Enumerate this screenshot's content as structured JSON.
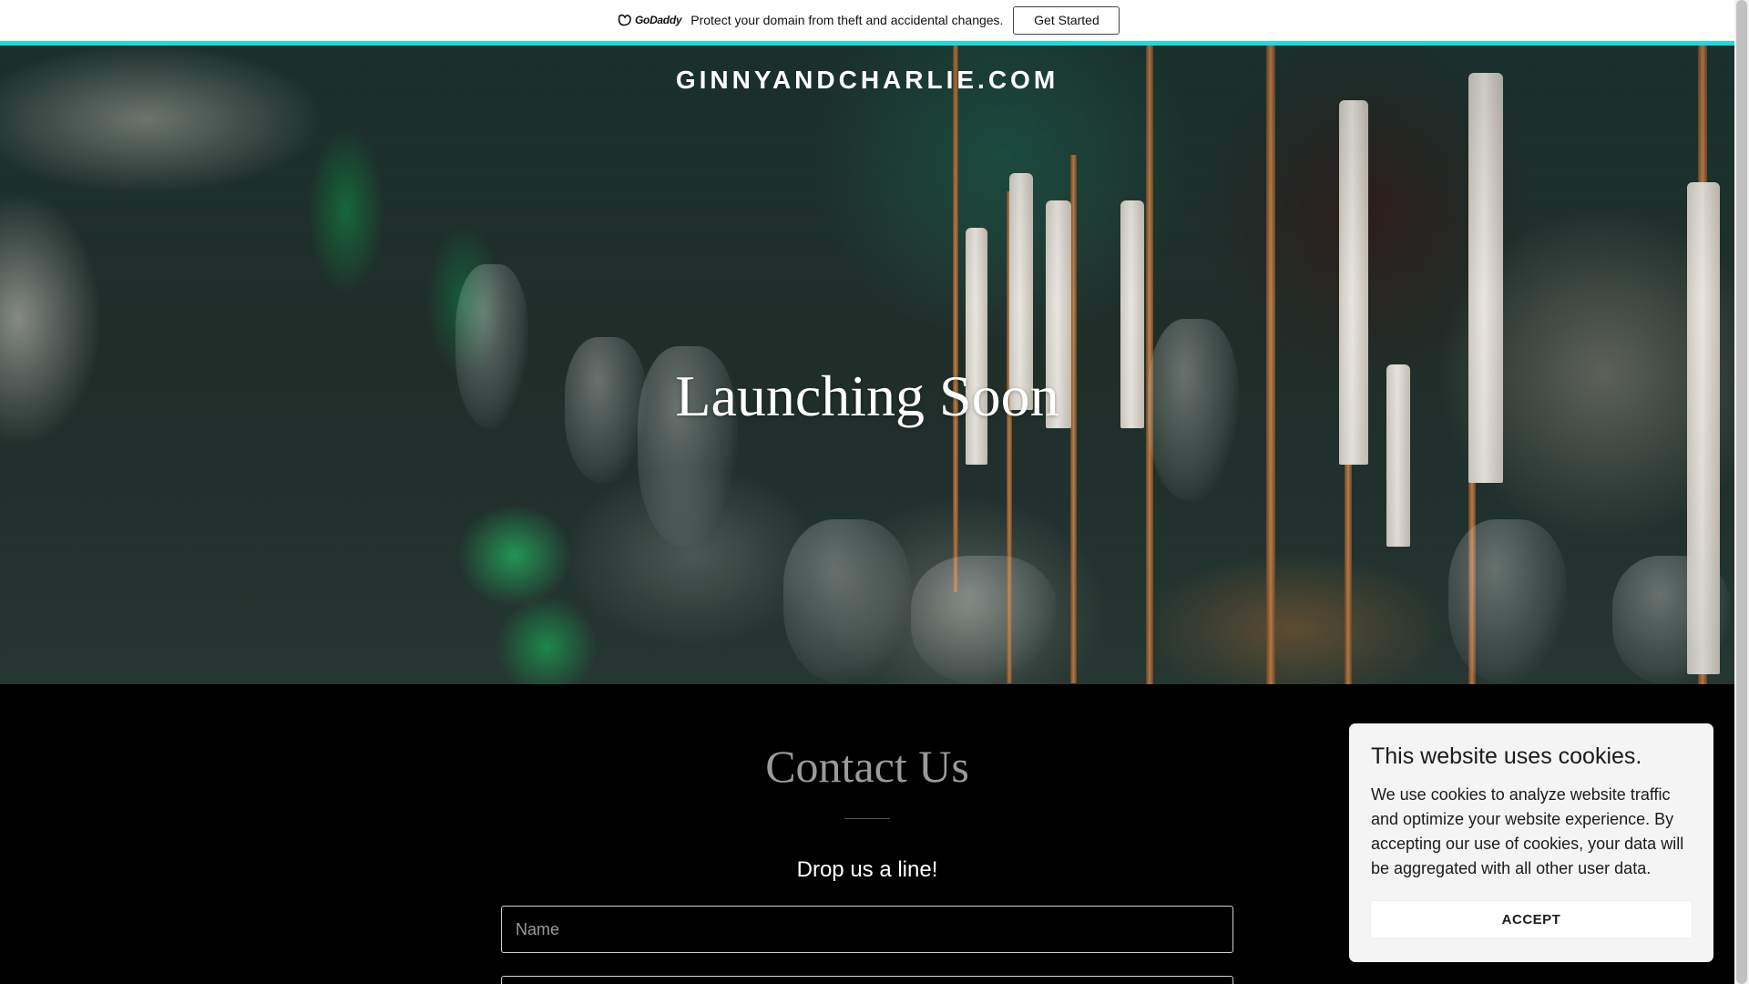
{
  "promo_bar": {
    "logo_text": "GoDaddy",
    "message": "Protect your domain from theft and accidental changes.",
    "button_label": "Get Started"
  },
  "hero": {
    "site_title": "GINNYANDCHARLIE.COM",
    "heading": "Launching Soon"
  },
  "contact": {
    "heading": "Contact Us",
    "subheading": "Drop us a line!",
    "name_placeholder": "Name",
    "email_placeholder": ""
  },
  "cookie_banner": {
    "title": "This website uses cookies.",
    "body": "We use cookies to analyze website traffic and optimize your website experience. By accepting our use of cookies, your data will be aggregated with all other user data.",
    "accept_label": "ACCEPT"
  },
  "colors": {
    "promo_accent": "#1bdbdb",
    "page_background": "#000000",
    "cookie_background": "#f4f4f4"
  }
}
